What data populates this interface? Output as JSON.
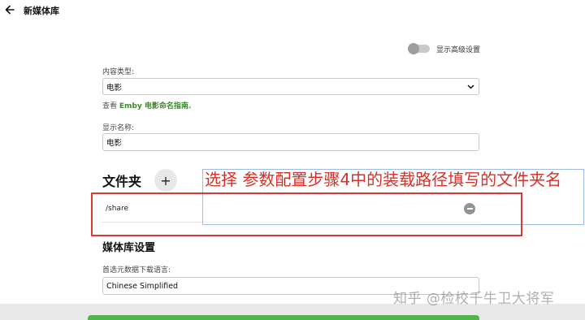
{
  "header": {
    "title": "新媒体库",
    "back_icon": "arrow-left-icon"
  },
  "advanced_toggle": {
    "label": "显示高级设置",
    "on": false
  },
  "content_type": {
    "label": "内容类型:",
    "value": "电影"
  },
  "naming_hint": {
    "prefix": "查看 ",
    "link": "Emby 电影命名指南",
    "suffix": "。"
  },
  "display_name": {
    "label": "显示名称:",
    "value": "电影"
  },
  "folders": {
    "title": "文件夹",
    "add_label": "+",
    "items": [
      {
        "path": "/share"
      }
    ]
  },
  "library_settings": {
    "title": "媒体库设置",
    "metadata_language_label": "首选元数据下载语言:",
    "metadata_language_value": "Chinese Simplified"
  },
  "annotation": {
    "text": "选择 参数配置步骤4中的装载路径填写的文件夹名",
    "color": "#d6322b"
  },
  "watermark": "知乎 @检校千牛卫大将军",
  "colors": {
    "accent": "#52b54b",
    "link": "#3a8a27",
    "highlight": "#d93a33"
  }
}
